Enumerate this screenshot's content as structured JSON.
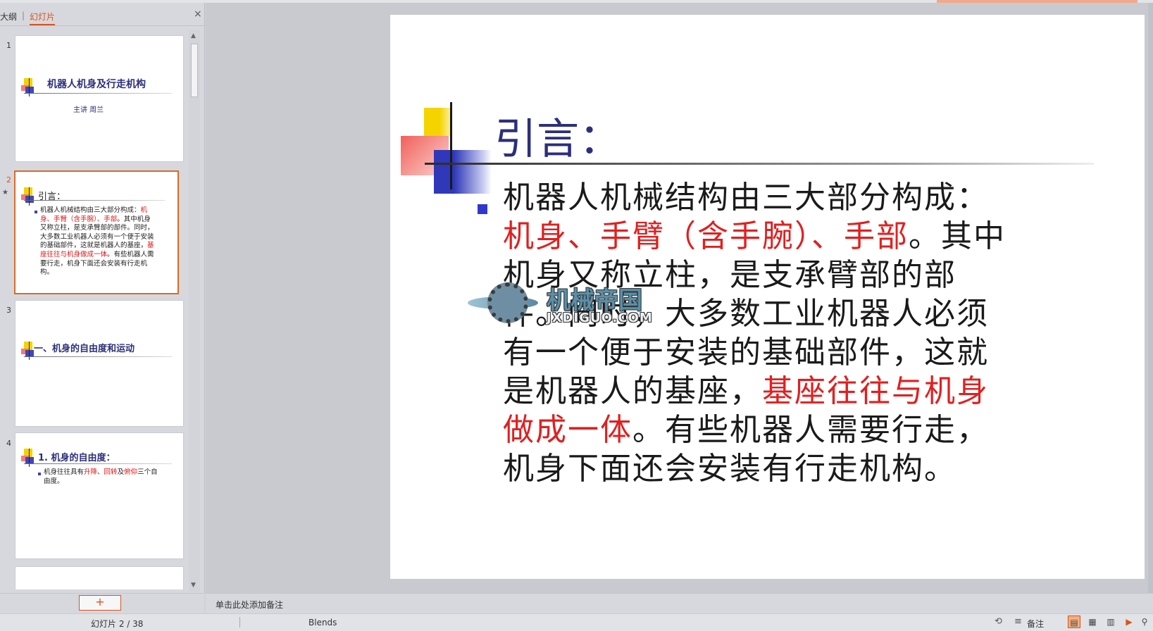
{
  "panel": {
    "tabs": [
      "大纲",
      "|",
      "幻灯片"
    ],
    "close_icon": "×"
  },
  "thumbnails": [
    {
      "num": "1",
      "title": "机器人机身及行走机构",
      "subtitle": "主讲  周兰"
    },
    {
      "num": "2",
      "title": "引言：",
      "body_parts": [
        "机器人机械结构由三大部分构成：",
        "机身、手臂（含手腕）、手部",
        "。其中机身又称立柱，是支承臂部的部件。同时，大多数工业机器人必须有一个便于安装的基础部件，这就是机器人的基座，",
        "基座往往与机身做成一体",
        "。有些机器人需要行走，机身下面还会安装有行走机构。"
      ]
    },
    {
      "num": "3",
      "title": "一、机身的自由度和运动"
    },
    {
      "num": "4",
      "title": "1. 机身的自由度：",
      "body_parts": [
        "机身往往具有",
        "升降",
        "、",
        "回转",
        "及",
        "俯仰",
        "三个自由度。"
      ]
    }
  ],
  "slide": {
    "title": "引言：",
    "body": {
      "p1": "机器人机械结构由三大部分构成：",
      "r1": "机身、手臂（含手腕）、手部",
      "p2": "。其中机身又称立柱，是支承臂部的部件。同时，大多数工业机器人必须有一个便于安装的基础部件，这就是机器人的基座，",
      "r2": "基座往往与机身做成一体",
      "p3": "。有些机器人需要行走，机身下面还会安装有行走机构。"
    },
    "watermark": {
      "text": "机械帝国",
      "url": "JXDIGUO.COM"
    }
  },
  "notes": {
    "placeholder": "单击此处添加备注"
  },
  "add_slide": "+",
  "status": {
    "slide_info": "幻灯片 2 / 38",
    "theme": "Blends",
    "notes_label": "备注"
  },
  "colors": {
    "accent": "#d9531e",
    "title": "#2b2f7a",
    "highlight": "#e02020"
  }
}
